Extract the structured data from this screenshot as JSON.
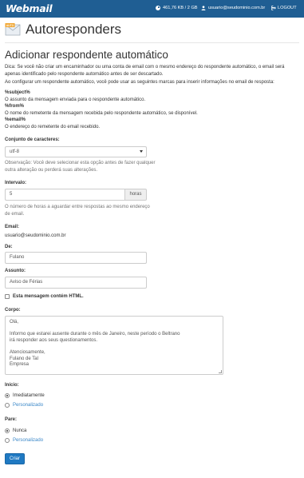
{
  "header": {
    "logo": "Webmail",
    "disk_usage": "461,76 KB / 2 GB",
    "user_email": "usuario@seudominio.com.br",
    "logout": "LOGOUT"
  },
  "page": {
    "title": "Autoresponders",
    "icon_label": "AUTO"
  },
  "form": {
    "heading": "Adicionar respondente automático",
    "tip": "Dica: Se você não criar um encaminhador ou uma conta de email com o mesmo endereço do respondente automático, o email será apenas identificado pelo respondente automático antes de ser descartado.",
    "tags_intro": "Ao configurar um respondente automático, você pode usar as seguintes marcas para inserir informações no email de resposta:",
    "tags": [
      {
        "tag": "%subject%",
        "desc": "O assunto da mensagem enviada para o respondente automático."
      },
      {
        "tag": "%from%",
        "desc": "O nome do remetente da mensagem recebida pelo respondente automático, se disponível."
      },
      {
        "tag": "%email%",
        "desc": "O endereço do remetente do email recebido."
      }
    ],
    "charset": {
      "label": "Conjunto de caracteres:",
      "value": "utf-8",
      "note": "Observação: Você deve selecionar esta opção antes de fazer qualquer outra alteração ou perderá suas alterações."
    },
    "interval": {
      "label": "Intervalo:",
      "value": "5",
      "unit": "horas",
      "help": "O número de horas a aguardar entre respostas ao mesmo endereço de email."
    },
    "email": {
      "label": "Email:",
      "value": "usuario@seudominio.com.br"
    },
    "from": {
      "label": "De:",
      "value": "Fulano"
    },
    "subject": {
      "label": "Assunto:",
      "value": "Aviso de Férias"
    },
    "html_checkbox": "Esta mensagem contém HTML.",
    "body": {
      "label": "Corpo:",
      "lines": [
        "Olá,",
        "",
        "Informo que estarei ausente durante o mês de Janeiro, neste período o Beltrano",
        "irá responder aos seus questionamentos.",
        "",
        "Atenciosamente,",
        "Fulano de Tal",
        "Empresa"
      ]
    },
    "start": {
      "label": "Início:",
      "options": [
        "Imediatamente",
        "Personalizado"
      ]
    },
    "stop": {
      "label": "Pare:",
      "options": [
        "Nunca",
        "Personalizado"
      ]
    },
    "submit": "Criar"
  }
}
